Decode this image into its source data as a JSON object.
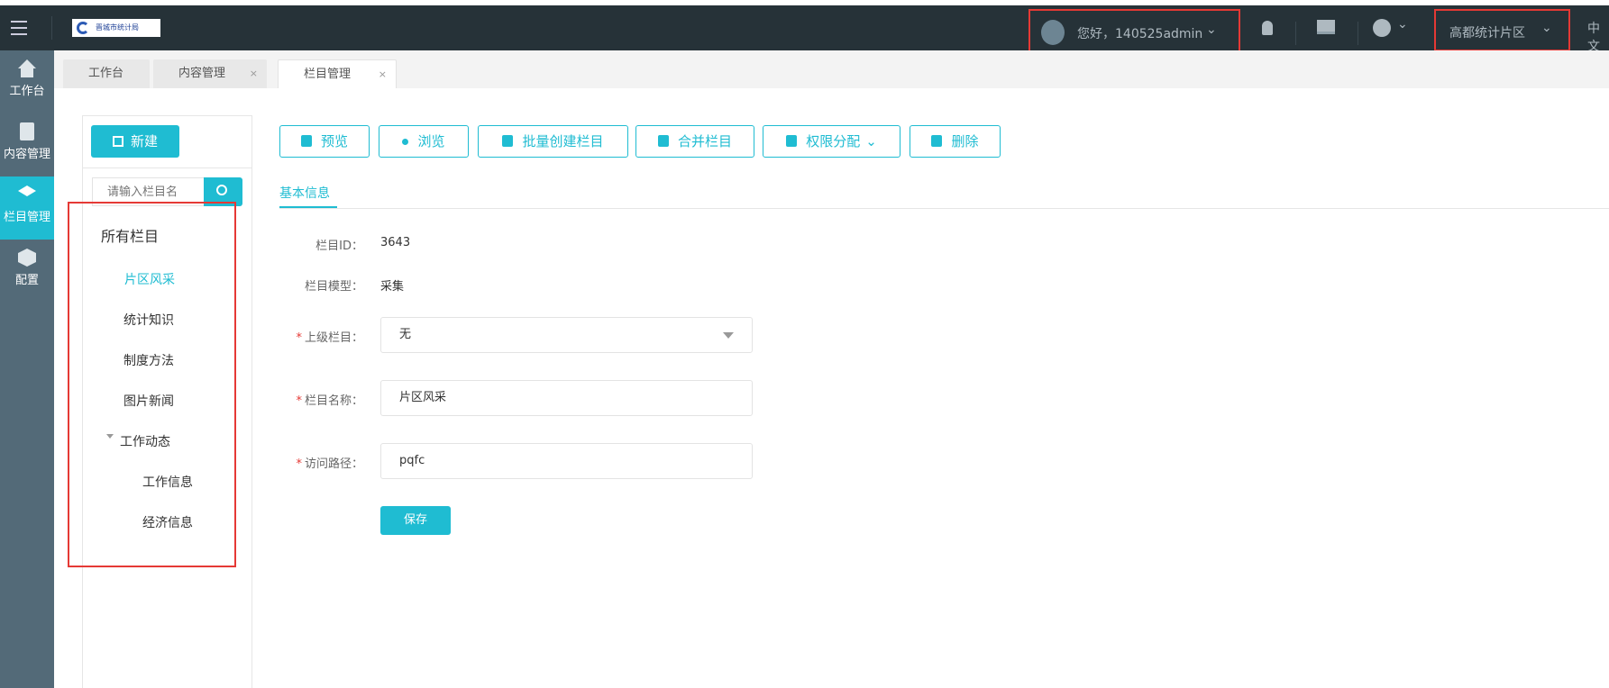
{
  "topbar": {
    "logo_text": "晋城市统计局",
    "greeting": "您好，140525admin",
    "region": "高都统计片区",
    "language": "中文"
  },
  "sidebar": {
    "items": [
      {
        "label": "工作台",
        "icon": "home-icon"
      },
      {
        "label": "内容管理",
        "icon": "document-icon"
      },
      {
        "label": "栏目管理",
        "icon": "layers-icon",
        "active": true
      },
      {
        "label": "配置",
        "icon": "cube-icon"
      }
    ]
  },
  "tabs": [
    {
      "label": "工作台"
    },
    {
      "label": "内容管理",
      "close": "×"
    },
    {
      "label": "栏目管理",
      "close": "×",
      "active": true
    }
  ],
  "left_panel": {
    "new_label": "新建",
    "search_placeholder": "请输入栏目名",
    "tree": {
      "root": "所有栏目",
      "items": [
        "片区风采",
        "统计知识",
        "制度方法",
        "图片新闻",
        "工作动态"
      ],
      "children": [
        "工作信息",
        "经济信息"
      ],
      "selected": "片区风采"
    }
  },
  "toolbar": {
    "preview": "预览",
    "browse": "浏览",
    "batch_create": "批量创建栏目",
    "merge": "合并栏目",
    "permissions": "权限分配",
    "delete": "删除"
  },
  "form": {
    "tab": "基本信息",
    "id_label": "栏目ID：",
    "id_value": "3643",
    "model_label": "栏目模型：",
    "model_value": "采集",
    "parent_label": "上级栏目：",
    "parent_value": "无",
    "name_label": "栏目名称：",
    "name_value": "片区风采",
    "path_label": "访问路径：",
    "path_value": "pqfc",
    "required_mark": "*",
    "save": "保存"
  },
  "colors": {
    "accent": "#1fbcd2",
    "topbar": "#263238",
    "sidebar": "#536a78",
    "highlight": "#e53935"
  }
}
